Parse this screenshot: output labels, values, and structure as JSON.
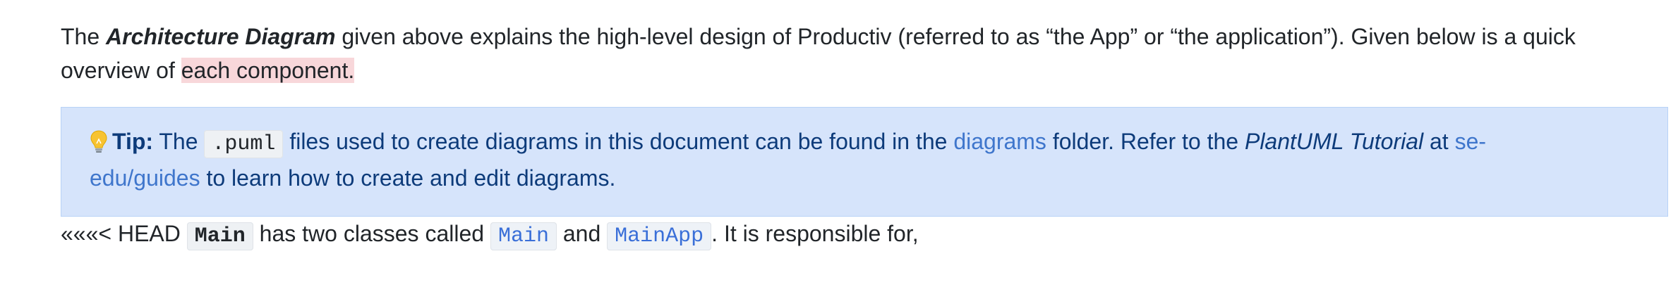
{
  "intro": {
    "prefix": "The ",
    "emph": "Architecture Diagram",
    "middle": " given above explains the high-level design of Productiv (referred to as “the App” or “the application”). Given below is a quick overview of ",
    "highlighted": "each component."
  },
  "tip": {
    "icon": "lightbulb-icon",
    "label": "Tip:",
    "before_code": " The ",
    "code": ".puml",
    "after_code": " files used to create diagrams in this document can be found in the ",
    "link_diagrams": "diagrams",
    "after_link": " folder. Refer to the ",
    "italic": "PlantUML Tutorial",
    "after_italic": " at ",
    "link_guides": "se-edu/guides",
    "end": " to learn how to create and edit diagrams."
  },
  "main_line": {
    "prefix": "«««< HEAD ",
    "code_main_bold": "Main",
    "text1": " has two classes called ",
    "code_main": "Main",
    "text2": " and ",
    "code_mainapp": "MainApp",
    "text3": ". It is responsible for,"
  },
  "colors": {
    "tip_background": "#d6e4fb",
    "tip_text": "#0d3b7a",
    "link": "#3a78d6",
    "highlight": "#f8d7da"
  }
}
